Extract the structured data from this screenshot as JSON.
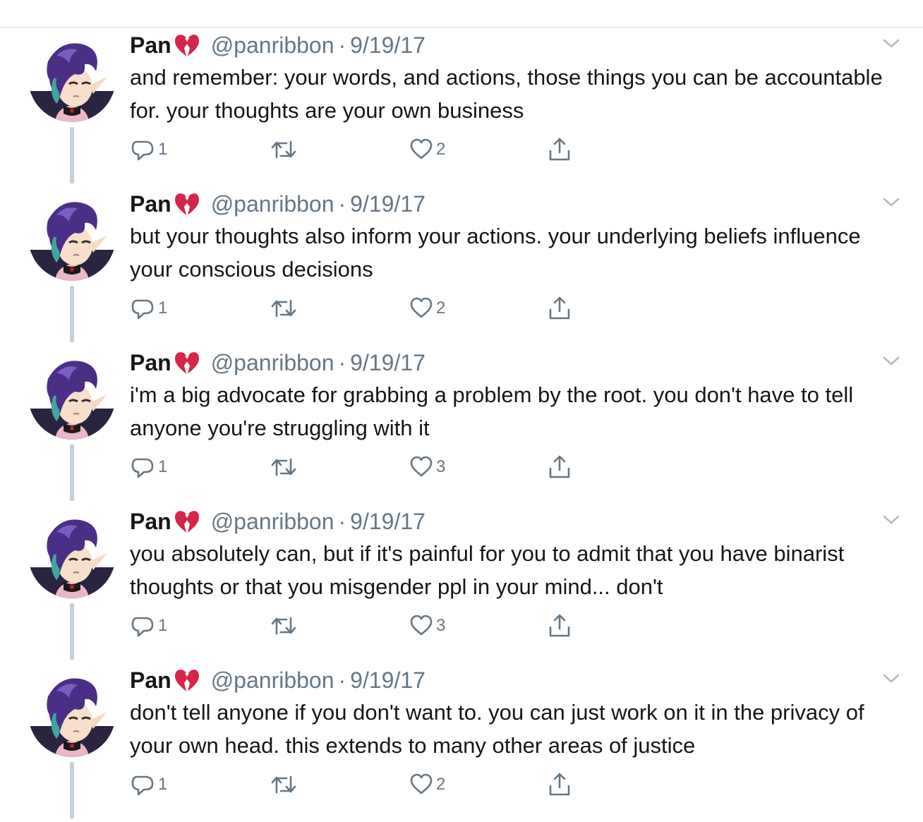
{
  "tweets": [
    {
      "name": "Pan",
      "name_emoji": "broken-heart-emoji",
      "handle": "@panribbon",
      "separator": "·",
      "date": "9/19/17",
      "text": "and remember: your words, and actions, those things you can be accountable for. your thoughts are your own business",
      "reply_count": "1",
      "like_count": "2"
    },
    {
      "name": "Pan",
      "name_emoji": "broken-heart-emoji",
      "handle": "@panribbon",
      "separator": "·",
      "date": "9/19/17",
      "text": "but your thoughts also inform your actions. your underlying beliefs influence your conscious decisions",
      "reply_count": "1",
      "like_count": "2"
    },
    {
      "name": "Pan",
      "name_emoji": "broken-heart-emoji",
      "handle": "@panribbon",
      "separator": "·",
      "date": "9/19/17",
      "text": "i'm a big advocate for grabbing a problem by the root. you don't have to tell anyone you're struggling with it",
      "reply_count": "1",
      "like_count": "3"
    },
    {
      "name": "Pan",
      "name_emoji": "broken-heart-emoji",
      "handle": "@panribbon",
      "separator": "·",
      "date": "9/19/17",
      "text": "you absolutely can, but if it's painful for you to admit that you have binarist thoughts or that you misgender ppl in your mind... don't",
      "reply_count": "1",
      "like_count": "3"
    },
    {
      "name": "Pan",
      "name_emoji": "broken-heart-emoji",
      "handle": "@panribbon",
      "separator": "·",
      "date": "9/19/17",
      "text": "don't tell anyone if you don't want to. you can just work on it in the privacy of your own head. this extends to many other areas of justice",
      "reply_count": "1",
      "like_count": "2"
    }
  ],
  "icons": {
    "reply": "reply-icon",
    "retweet": "retweet-icon",
    "like": "heart-icon",
    "share": "share-icon",
    "more": "chevron-down-icon"
  },
  "colors": {
    "text": "#14171a",
    "secondary": "#657786",
    "thread_line": "#c8d0d8",
    "avatar_hair": "#4b2f86",
    "broken_heart": "#d6244a"
  }
}
